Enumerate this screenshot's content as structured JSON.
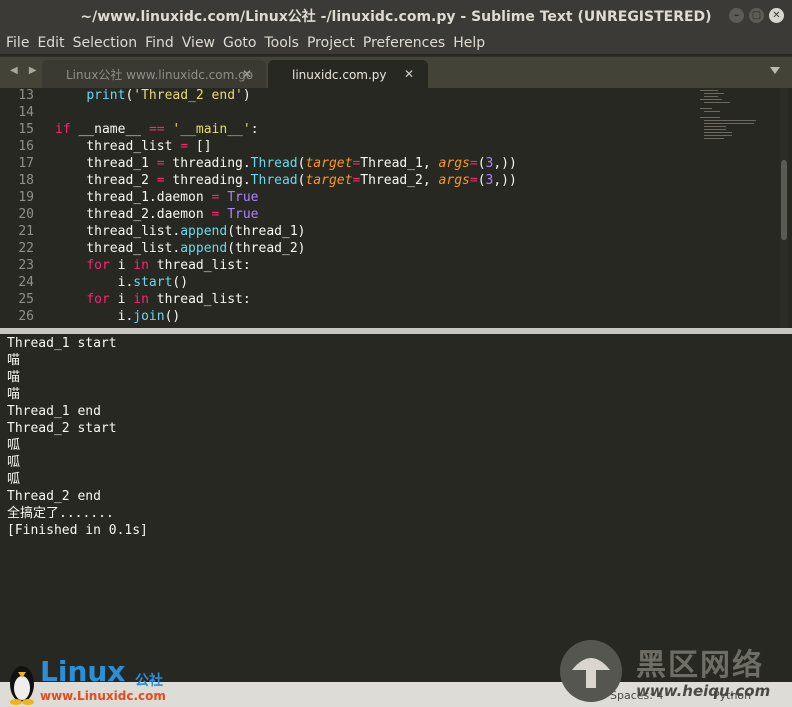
{
  "window": {
    "title": "~/www.linuxidc.com/Linux公社 -/linuxidc.com.py - Sublime Text (UNREGISTERED)",
    "controls": {
      "minimize": "–",
      "maximize": "▢",
      "close": "✕"
    }
  },
  "menu": [
    "File",
    "Edit",
    "Selection",
    "Find",
    "View",
    "Goto",
    "Tools",
    "Project",
    "Preferences",
    "Help"
  ],
  "tabs": {
    "nav": "◀ ▶",
    "items": [
      {
        "label": "Linux公社 www.linuxidc.com.go",
        "close": "✕",
        "active": false
      },
      {
        "label": "linuxidc.com.py",
        "close": "✕",
        "active": true
      }
    ]
  },
  "editor": {
    "lines": [
      {
        "num": "13",
        "text": "    print('Thread_2 end')"
      },
      {
        "num": "14",
        "text": ""
      },
      {
        "num": "15",
        "text": "if __name__ == '__main__':"
      },
      {
        "num": "16",
        "text": "    thread_list = []"
      },
      {
        "num": "17",
        "text": "    thread_1 = threading.Thread(target=Thread_1, args=(3,))"
      },
      {
        "num": "18",
        "text": "    thread_2 = threading.Thread(target=Thread_2, args=(3,))"
      },
      {
        "num": "19",
        "text": "    thread_1.daemon = True"
      },
      {
        "num": "20",
        "text": "    thread_2.daemon = True"
      },
      {
        "num": "21",
        "text": "    thread_list.append(thread_1)"
      },
      {
        "num": "22",
        "text": "    thread_list.append(thread_2)"
      },
      {
        "num": "23",
        "text": "    for i in thread_list:"
      },
      {
        "num": "24",
        "text": "        i.start()"
      },
      {
        "num": "25",
        "text": "    for i in thread_list:"
      },
      {
        "num": "26",
        "text": "        i.join()"
      }
    ]
  },
  "output": {
    "lines": [
      "Thread_1 start",
      "喵",
      "喵",
      "喵",
      "Thread_1 end",
      "Thread_2 start",
      "呱",
      "呱",
      "呱",
      "Thread_2 end",
      "全搞定了.......",
      "[Finished in 0.1s]"
    ]
  },
  "status": {
    "spaces": "Spaces: 4",
    "syntax": "Python"
  },
  "watermarks": {
    "linux": "Linux",
    "gongshe": "公社",
    "linux_site": "www.Linuxidc.com",
    "heiqu": "黑区网络",
    "heiqu_site": "www.heiqu.com"
  },
  "colors": {
    "background": "#272822",
    "keyword": "#f92672",
    "string": "#e6db74",
    "function": "#66d9ef",
    "argument": "#fd971f",
    "number": "#ae81ff"
  }
}
